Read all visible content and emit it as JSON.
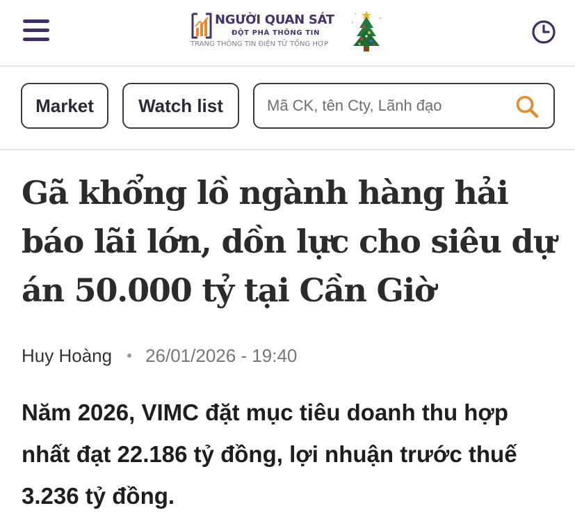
{
  "header": {
    "menu_icon": "hamburger-menu-icon",
    "logo": {
      "title": "NGƯỜI QUAN SÁT",
      "slogan": "ĐỘT PHÁ THÔNG TIN",
      "description": "TRANG THÔNG TIN ĐIỆN TỬ TỔNG HỢP",
      "decoration": "christmas-tree-icon"
    },
    "history_icon": "clock-icon"
  },
  "toolbar": {
    "market_label": "Market",
    "watchlist_label": "Watch list",
    "search": {
      "placeholder": "Mã CK, tên Cty, Lãnh đạo",
      "value": "",
      "icon": "search-icon"
    }
  },
  "article": {
    "title": "Gã khổng lồ ngành hàng hải báo lãi lớn, dồn lực cho siêu dự án 50.000 tỷ tại Cần Giờ",
    "author": "Huy Hoàng",
    "datetime": "26/01/2026 - 19:40",
    "sapo": "Năm 2026, VIMC đặt mục tiêu doanh thu hợp nhất đạt 22.186 tỷ đồng, lợi nhuận trước thuế 3.236 tỷ đồng."
  },
  "colors": {
    "brand": "#44336e",
    "accent_orange": "#e88a2a",
    "border": "#3a3a3a",
    "divider": "#e6e6e6"
  }
}
